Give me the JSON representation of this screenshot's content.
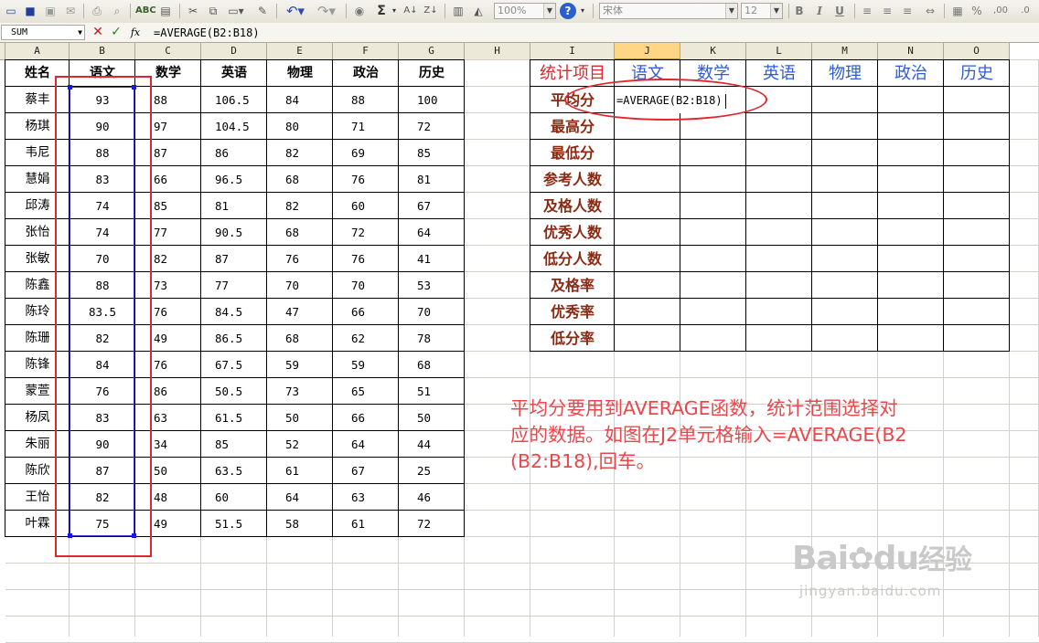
{
  "toolbar": {
    "zoom": "100%",
    "font_name": "宋体",
    "font_size": "12",
    "sum_symbol": "Σ",
    "bold": "B",
    "italic": "I",
    "underline": "U",
    "percent": "%"
  },
  "formula_bar": {
    "name_box": "SUM",
    "cancel_icon": "✕",
    "enter_icon": "✓",
    "fx": "fx",
    "formula": "=AVERAGE(B2:B18)"
  },
  "columns": [
    "A",
    "B",
    "C",
    "D",
    "E",
    "F",
    "G",
    "H",
    "I",
    "J",
    "K",
    "L",
    "M",
    "N",
    "O"
  ],
  "headers": [
    "姓名",
    "语文",
    "数学",
    "英语",
    "物理",
    "政治",
    "历史"
  ],
  "rows": [
    [
      "蔡丰",
      "93",
      "88",
      "106.5",
      "84",
      "88",
      "100"
    ],
    [
      "杨琪",
      "90",
      "97",
      "104.5",
      "80",
      "71",
      "72"
    ],
    [
      "韦尼",
      "88",
      "87",
      "86",
      "82",
      "69",
      "85"
    ],
    [
      "慧娟",
      "83",
      "66",
      "96.5",
      "68",
      "76",
      "81"
    ],
    [
      "邱涛",
      "74",
      "85",
      "81",
      "82",
      "60",
      "67"
    ],
    [
      "张怡",
      "74",
      "77",
      "90.5",
      "68",
      "72",
      "64"
    ],
    [
      "张敏",
      "70",
      "82",
      "87",
      "76",
      "76",
      "41"
    ],
    [
      "陈鑫",
      "88",
      "73",
      "77",
      "70",
      "70",
      "53"
    ],
    [
      "陈玲",
      "83.5",
      "76",
      "84.5",
      "47",
      "66",
      "70"
    ],
    [
      "陈珊",
      "82",
      "49",
      "86.5",
      "68",
      "62",
      "78"
    ],
    [
      "陈锋",
      "84",
      "76",
      "67.5",
      "59",
      "59",
      "68"
    ],
    [
      "蒙萱",
      "76",
      "86",
      "50.5",
      "73",
      "65",
      "51"
    ],
    [
      "杨凤",
      "83",
      "63",
      "61.5",
      "50",
      "66",
      "50"
    ],
    [
      "朱丽",
      "90",
      "34",
      "85",
      "52",
      "64",
      "44"
    ],
    [
      "陈欣",
      "87",
      "50",
      "63.5",
      "61",
      "67",
      "25"
    ],
    [
      "王怡",
      "82",
      "48",
      "60",
      "64",
      "63",
      "46"
    ],
    [
      "叶霖",
      "75",
      "49",
      "51.5",
      "58",
      "61",
      "72"
    ]
  ],
  "stats": {
    "header": "统计项目",
    "subjects": [
      "语文",
      "数学",
      "英语",
      "物理",
      "政治",
      "历史"
    ],
    "items": [
      "平均分",
      "最高分",
      "最低分",
      "参考人数",
      "及格人数",
      "优秀人数",
      "低分人数",
      "及格率",
      "优秀率",
      "低分率"
    ],
    "editing_cell": "=AVERAGE(B2:B18)"
  },
  "caption": {
    "line1": "平均分要用到AVERAGE函数，统计范围选择对",
    "line2": "应的数据。如图在J2单元格输入=AVERAGE(B2",
    "line3": "(B2:B18),回车。"
  },
  "watermark": {
    "brand": "Bai",
    "brand2": "du",
    "suffix": "经验",
    "url": "jingyan.baidu.com"
  },
  "colors": {
    "selection_box": "#e0262f",
    "subject_text": "#2f5bd6",
    "stat_text": "#8a2a12",
    "caption_text": "#e8474c",
    "active_header": "#ffd586"
  }
}
